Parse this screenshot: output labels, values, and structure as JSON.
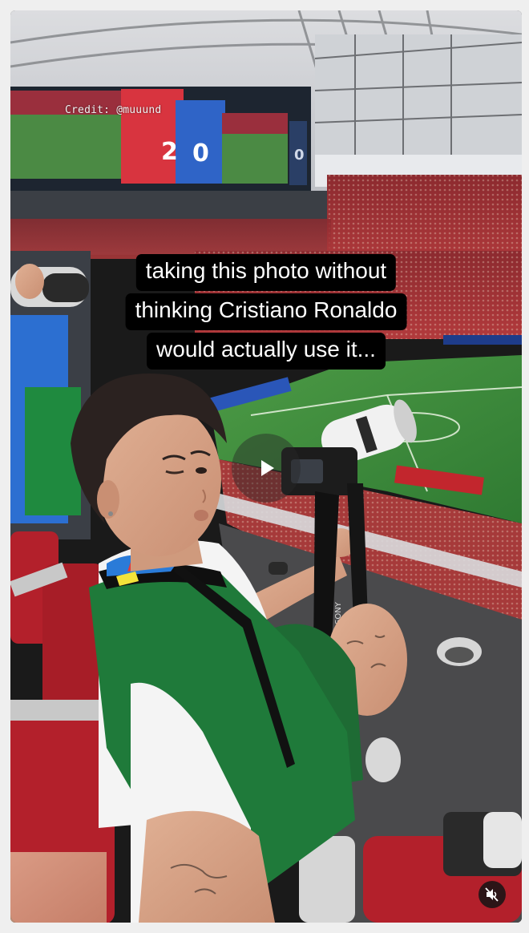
{
  "overlay": {
    "credit": "Credit: @muuund",
    "scoreboard": {
      "home_score": "2",
      "away_score": "0",
      "side_score": "0"
    },
    "caption_lines": [
      "taking this photo without",
      "thinking Cristiano Ronaldo",
      "would actually use it..."
    ],
    "camera_brand": "SONY"
  },
  "controls": {
    "play_icon": "play-icon",
    "mute_icon": "speaker-muted-icon"
  },
  "colors": {
    "caption_bg": "#000000",
    "caption_text": "#ffffff",
    "pitch_green": "#3f8a3a",
    "seat_red": "#b3202b",
    "vest_green": "#1f7a3a"
  }
}
